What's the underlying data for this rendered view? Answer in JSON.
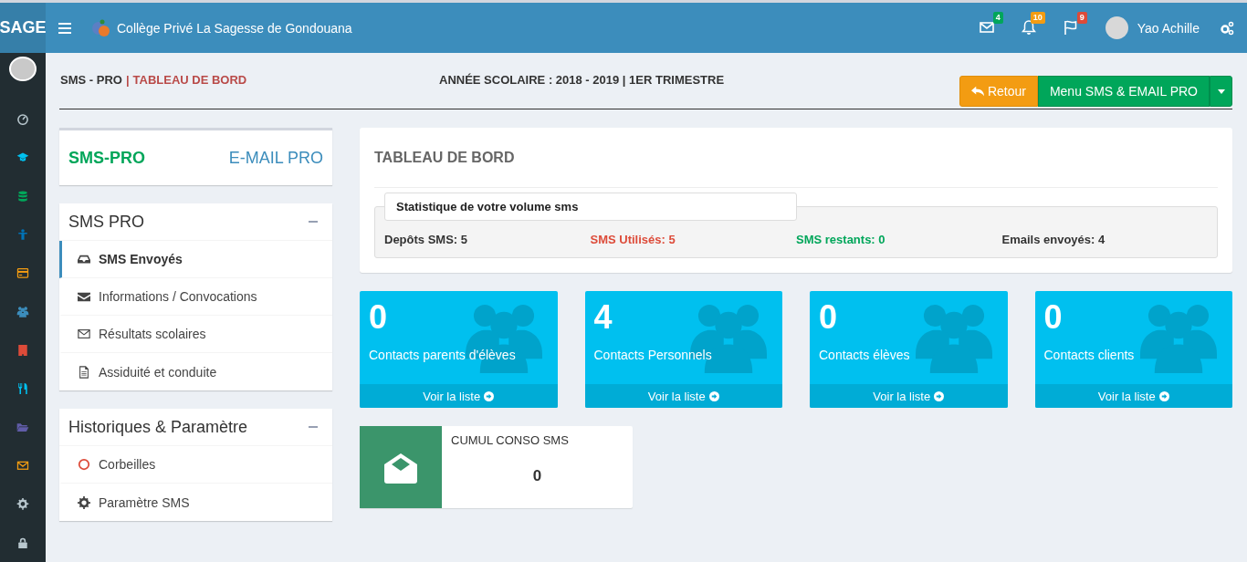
{
  "app": {
    "logo": "SAGE",
    "school": "Collège Privé La Sagesse de Gondouana"
  },
  "notifications": [
    {
      "kind": "mail",
      "count": "4",
      "color": "#00a65a"
    },
    {
      "kind": "bell",
      "count": "10",
      "color": "#f39c12"
    },
    {
      "kind": "flag",
      "count": "9",
      "color": "#dd4b39"
    }
  ],
  "user": {
    "name": "Yao Achille"
  },
  "rail": [
    {
      "kind": "dashboard",
      "color": "#b8c7ce"
    },
    {
      "kind": "cap",
      "color": "#00c0ef"
    },
    {
      "kind": "database",
      "color": "#00a65a"
    },
    {
      "kind": "person",
      "color": "#0073b7"
    },
    {
      "kind": "card",
      "color": "#f39c12"
    },
    {
      "kind": "users",
      "color": "#3c8dbc"
    },
    {
      "kind": "building",
      "color": "#dd4b39"
    },
    {
      "kind": "utensils",
      "color": "#00c0ef"
    },
    {
      "kind": "folder",
      "color": "#605ca8"
    },
    {
      "kind": "mail",
      "color": "#f39c12"
    },
    {
      "kind": "gear",
      "color": "#b8c7ce"
    },
    {
      "kind": "lock",
      "color": "#b8c7ce"
    }
  ],
  "breadcrumb": {
    "module": "SMS - PRO",
    "separator": "|",
    "page": "TABLEAU DE BORD"
  },
  "school_year": "ANNÉE SCOLAIRE : 2018 - 2019 | 1ER TRIMESTRE",
  "actions": {
    "back": "Retour",
    "menu": "Menu SMS & EMAIL PRO"
  },
  "switcher": [
    {
      "label": "SMS-PRO",
      "selected": true
    },
    {
      "label": "E-MAIL PRO",
      "selected": false
    }
  ],
  "menus": [
    {
      "title": "SMS PRO",
      "expanded": true,
      "items": [
        {
          "kind": "inbox",
          "label": "SMS Envoyés",
          "selected": true
        },
        {
          "kind": "envelope",
          "label": "Informations / Convocations",
          "selected": false
        },
        {
          "kind": "envelope-outline",
          "label": "Résultats scolaires",
          "selected": false
        },
        {
          "kind": "file",
          "label": "Assiduité et conduite",
          "selected": false
        }
      ]
    },
    {
      "title": "Historiques & Paramètre",
      "expanded": true,
      "items": [
        {
          "kind": "ring",
          "label": "Corbeilles",
          "selected": false
        },
        {
          "kind": "gear",
          "label": "Paramètre SMS",
          "selected": false
        }
      ]
    }
  ],
  "dashboard": {
    "title": "TABLEAU DE BORD",
    "stats_title": "Statistique de votre volume sms",
    "stats": [
      {
        "label": "Depôts SMS: 5",
        "color": "#333333"
      },
      {
        "label": "SMS Utilisés: 5",
        "color": "#dd4b39"
      },
      {
        "label": "SMS restants: 0",
        "color": "#00a65a"
      },
      {
        "label": "Emails envoyés: 4",
        "color": "#333333"
      }
    ]
  },
  "tiles": [
    {
      "count": "0",
      "label": "Contacts parents d'élèves",
      "link": "Voir la liste"
    },
    {
      "count": "4",
      "label": "Contacts Personnels",
      "link": "Voir la liste"
    },
    {
      "count": "0",
      "label": "Contacts élèves",
      "link": "Voir la liste"
    },
    {
      "count": "0",
      "label": "Contacts clients",
      "link": "Voir la liste"
    }
  ],
  "cumul": {
    "title": "CUMUL CONSO SMS",
    "value": "0"
  }
}
